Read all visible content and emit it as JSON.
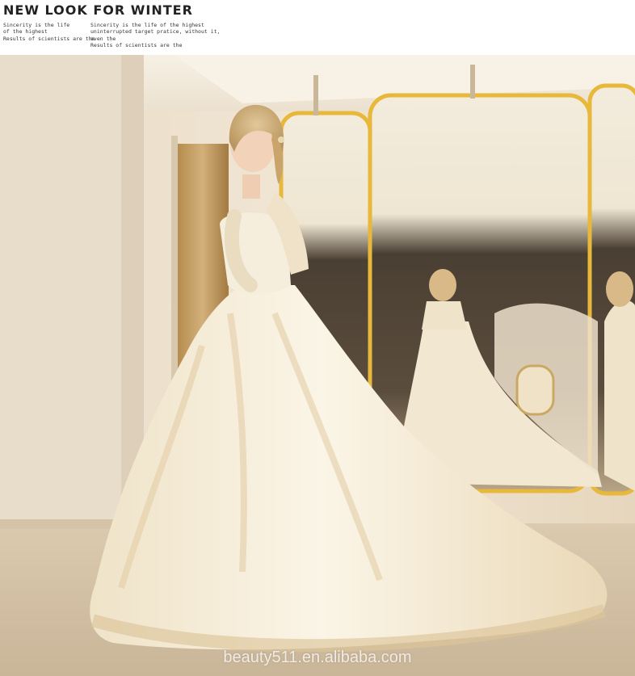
{
  "header": {
    "headline": "NEW LOOK FOR WINTER",
    "blurb_left": [
      "Sincerity is the life",
      "of the highest",
      "Results of scientists are the"
    ],
    "blurb_right": [
      "Sincerity is the life of the highest",
      "uninterrupted target pratice, without it,",
      "even the",
      "Results of scientists are the"
    ]
  },
  "photo": {
    "subject": "bride-in-lace-ball-gown",
    "watermark": "beauty511.en.alibaba.com"
  },
  "colors": {
    "wall": "#efe2cf",
    "mirror_frame": "#e7b83a",
    "gown": "#f4ecda",
    "floor": "#d9c7ac"
  }
}
